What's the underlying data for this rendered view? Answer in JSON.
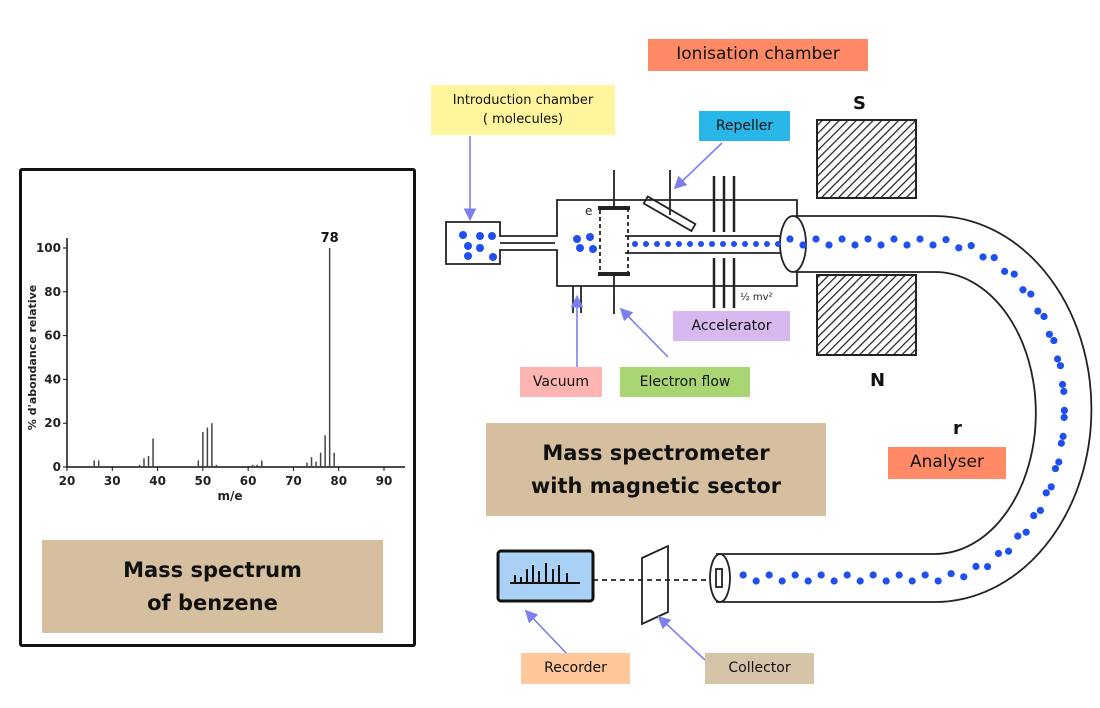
{
  "labels": {
    "ionisation": "Ionisation chamber",
    "introduction_line1": "Introduction chamber",
    "introduction_line2": "( molecules)",
    "repeller": "Repeller",
    "accelerator": "Accelerator",
    "vacuum": "Vacuum",
    "electron_flow": "Electron flow",
    "analyser": "Analyser",
    "title_line1": "Mass spectrometer",
    "title_line2": "with magnetic sector",
    "recorder": "Recorder",
    "collector": "Collector",
    "magnet_s": "S",
    "magnet_n": "N",
    "radius": "r",
    "electron_symbol": "e",
    "energy": "½ mv²",
    "spectrum_line1": "Mass spectrum",
    "spectrum_line2": "of benzene"
  },
  "colors": {
    "ionisation": "#ff8a65",
    "introduction": "#fff59d",
    "repeller": "#29b6e8",
    "accelerator": "#d7b9f0",
    "vacuum": "#ffb4b4",
    "electron_flow": "#a9d672",
    "analyser": "#ff8a65",
    "title": "#d5bf9f",
    "recorder": "#ffc79a",
    "collector": "#d5c4a8",
    "ions": "#1f4ff0",
    "arrows": "#7b7ff0",
    "recorder_screen": "#a9d0f5"
  },
  "chart_data": {
    "type": "bar",
    "xlabel": "m/e",
    "ylabel": "% d'abondance relative",
    "xlim": [
      20,
      95
    ],
    "ylim": [
      0,
      108
    ],
    "xticks": [
      20,
      30,
      40,
      50,
      60,
      70,
      80,
      90
    ],
    "yticks": [
      0,
      20,
      40,
      60,
      80,
      100
    ],
    "annotation": "78",
    "x": [
      25,
      26,
      27,
      36,
      37,
      38,
      39,
      49,
      50,
      51,
      52,
      53,
      61,
      62,
      63,
      73,
      74,
      75,
      76,
      77,
      78,
      79
    ],
    "values": [
      0.5,
      3,
      3,
      1,
      4,
      5,
      13,
      3,
      16,
      18,
      20,
      1,
      1,
      1,
      3,
      2,
      4.5,
      2.5,
      6.5,
      14.5,
      100,
      6.5
    ]
  }
}
